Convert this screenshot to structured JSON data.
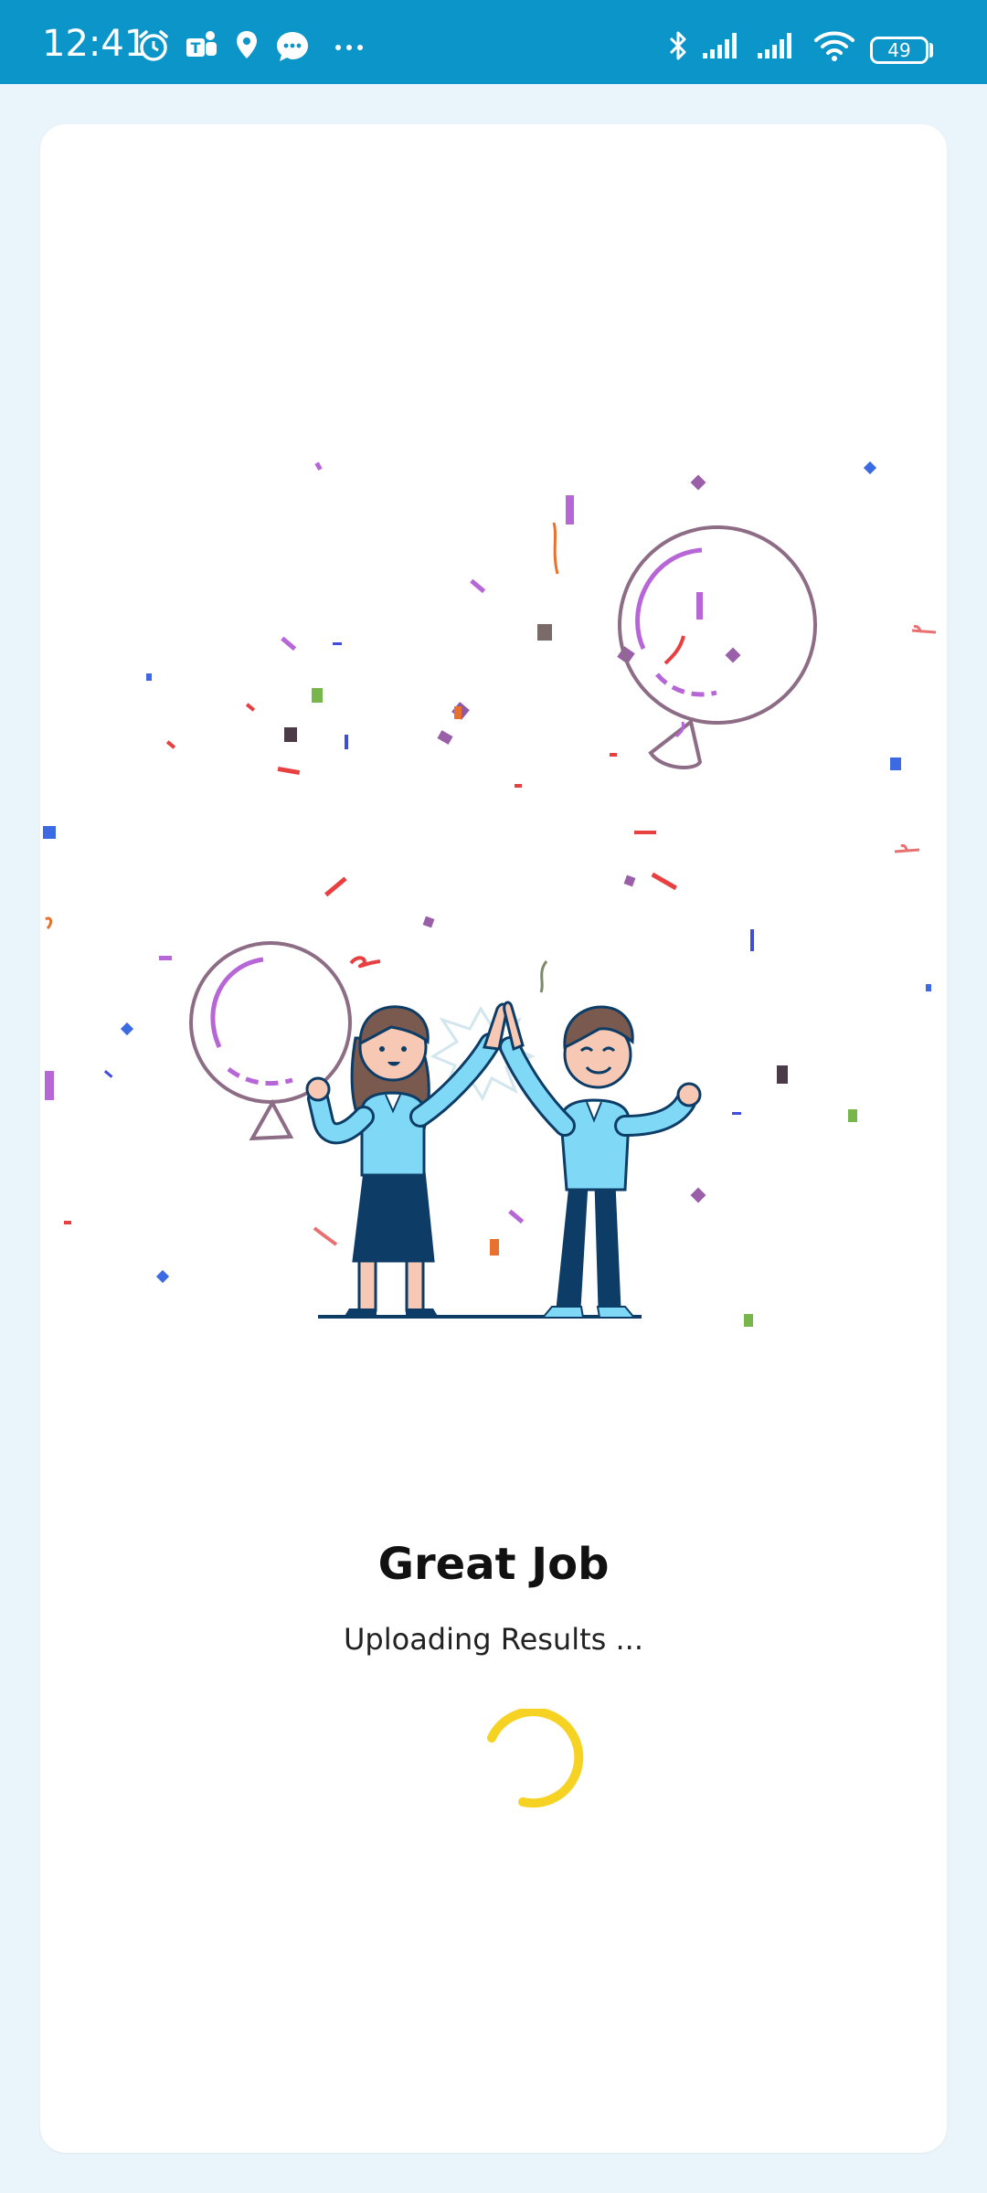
{
  "status_bar": {
    "time": "12:41",
    "battery": "49",
    "icons": [
      "alarm-icon",
      "teams-icon",
      "location-icon",
      "messages-icon",
      "more-icon",
      "bluetooth-icon",
      "signal-icon",
      "signal-icon",
      "wifi-icon",
      "battery-icon"
    ]
  },
  "result": {
    "title": "Great Job",
    "subtitle": "Uploading Results ..."
  },
  "colors": {
    "status_bar": "#0b95c9",
    "background": "#e9f4fb",
    "card": "#ffffff",
    "spinner": "#f6d322",
    "shirt": "#7fd8f5",
    "navy": "#0d3d66"
  }
}
